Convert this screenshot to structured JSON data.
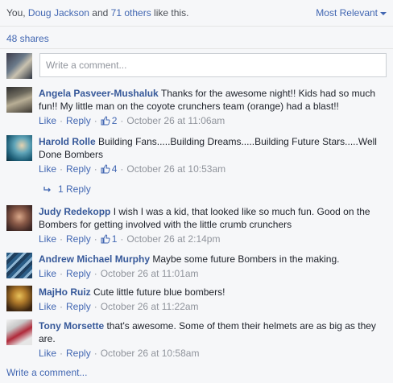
{
  "likes": {
    "prefix": "You, ",
    "friend": "Doug Jackson",
    "middle": " and ",
    "others": "71 others",
    "suffix": " like this."
  },
  "sort_label": "Most Relevant",
  "shares": "48 shares",
  "composer": {
    "placeholder": "Write a comment..."
  },
  "labels": {
    "like": "Like",
    "reply": "Reply"
  },
  "comments": [
    {
      "name": "Angela Pasveer-Mushaluk",
      "text": "Thanks for the awesome night!! Kids had so much fun!! My little man on the coyote crunchers team (orange) had a blast!!",
      "likes": "2",
      "time": "October 26 at 11:06am"
    },
    {
      "name": "Harold Rolle",
      "text": "Building Fans.....Building Dreams.....Building Future Stars.....Well Done Bombers",
      "likes": "4",
      "time": "October 26 at 10:53am",
      "replies": "1 Reply"
    },
    {
      "name": "Judy Redekopp",
      "text": "I wish I was a kid, that looked like so much fun. Good on the Bombers for getting involved with the little crumb crunchers",
      "likes": "1",
      "time": "October 26 at 2:14pm"
    },
    {
      "name": "Andrew Michael Murphy",
      "text": "Maybe some future Bombers in the making.",
      "time": "October 26 at 11:01am"
    },
    {
      "name": "MajHo Ruiz",
      "text": "Cute little future blue bombers!",
      "time": "October 26 at 11:22am"
    },
    {
      "name": "Tony Morsette",
      "text": "that's awesome. Some of them their helmets are as big as they are.",
      "time": "October 26 at 10:58am"
    }
  ],
  "write_comment": "Write a comment...",
  "colors": {
    "link": "#4267b2",
    "name": "#365899",
    "meta": "#90949c",
    "background": "#f6f7f9"
  }
}
